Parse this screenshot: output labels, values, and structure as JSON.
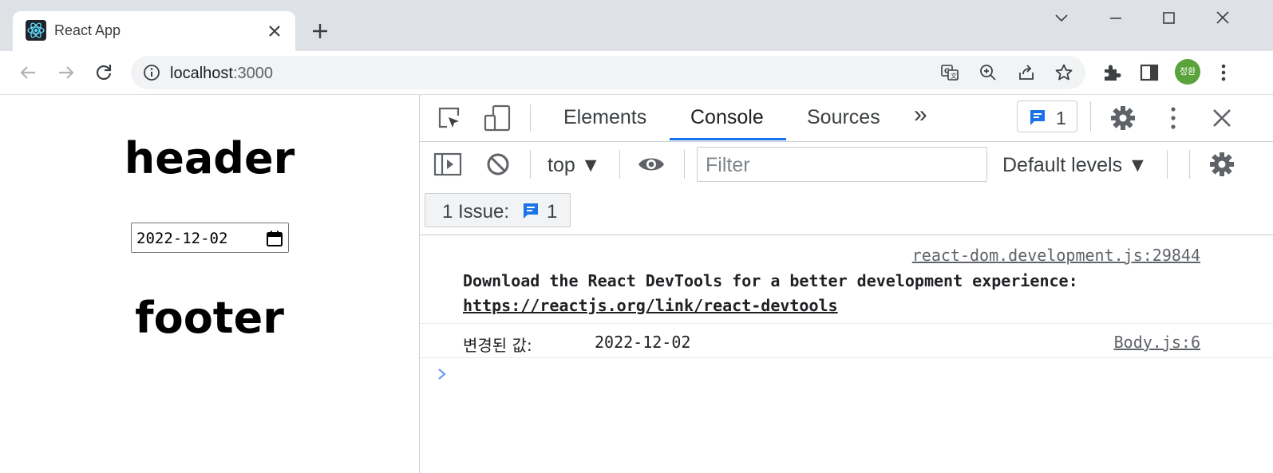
{
  "browser": {
    "tab_title": "React App",
    "url_host": "localhost",
    "url_port": ":3000",
    "profile_initials": "정환",
    "icons": [
      "react-favicon-icon",
      "close-icon",
      "plus-icon",
      "chevron-down-icon",
      "minimize-icon",
      "maximize-icon",
      "close-window-icon",
      "back-icon",
      "forward-icon",
      "reload-icon",
      "info-icon",
      "translate-icon",
      "zoom-icon",
      "share-icon",
      "star-icon",
      "extensions-icon",
      "side-panel-icon",
      "more-vert-icon"
    ]
  },
  "page": {
    "header": "header",
    "date_value": "2022-12-02",
    "footer": "footer"
  },
  "devtools": {
    "tabs": [
      "Elements",
      "Console",
      "Sources"
    ],
    "active_tab": "Console",
    "more_tabs": "»",
    "issues_badge_count": "1",
    "context": "top ▼",
    "filter_placeholder": "Filter",
    "levels": "Default levels ▼",
    "issues_label": "1 Issue:",
    "issues_count": "1",
    "messages": [
      {
        "source": "react-dom.development.js:29844",
        "text": "Download the React DevTools for a better development experience:",
        "link": "https://reactjs.org/link/react-devtools"
      },
      {
        "source": "Body.js:6",
        "label": "변경된 값:",
        "value": "2022-12-02"
      }
    ],
    "accent_color": "#1a73e8"
  }
}
